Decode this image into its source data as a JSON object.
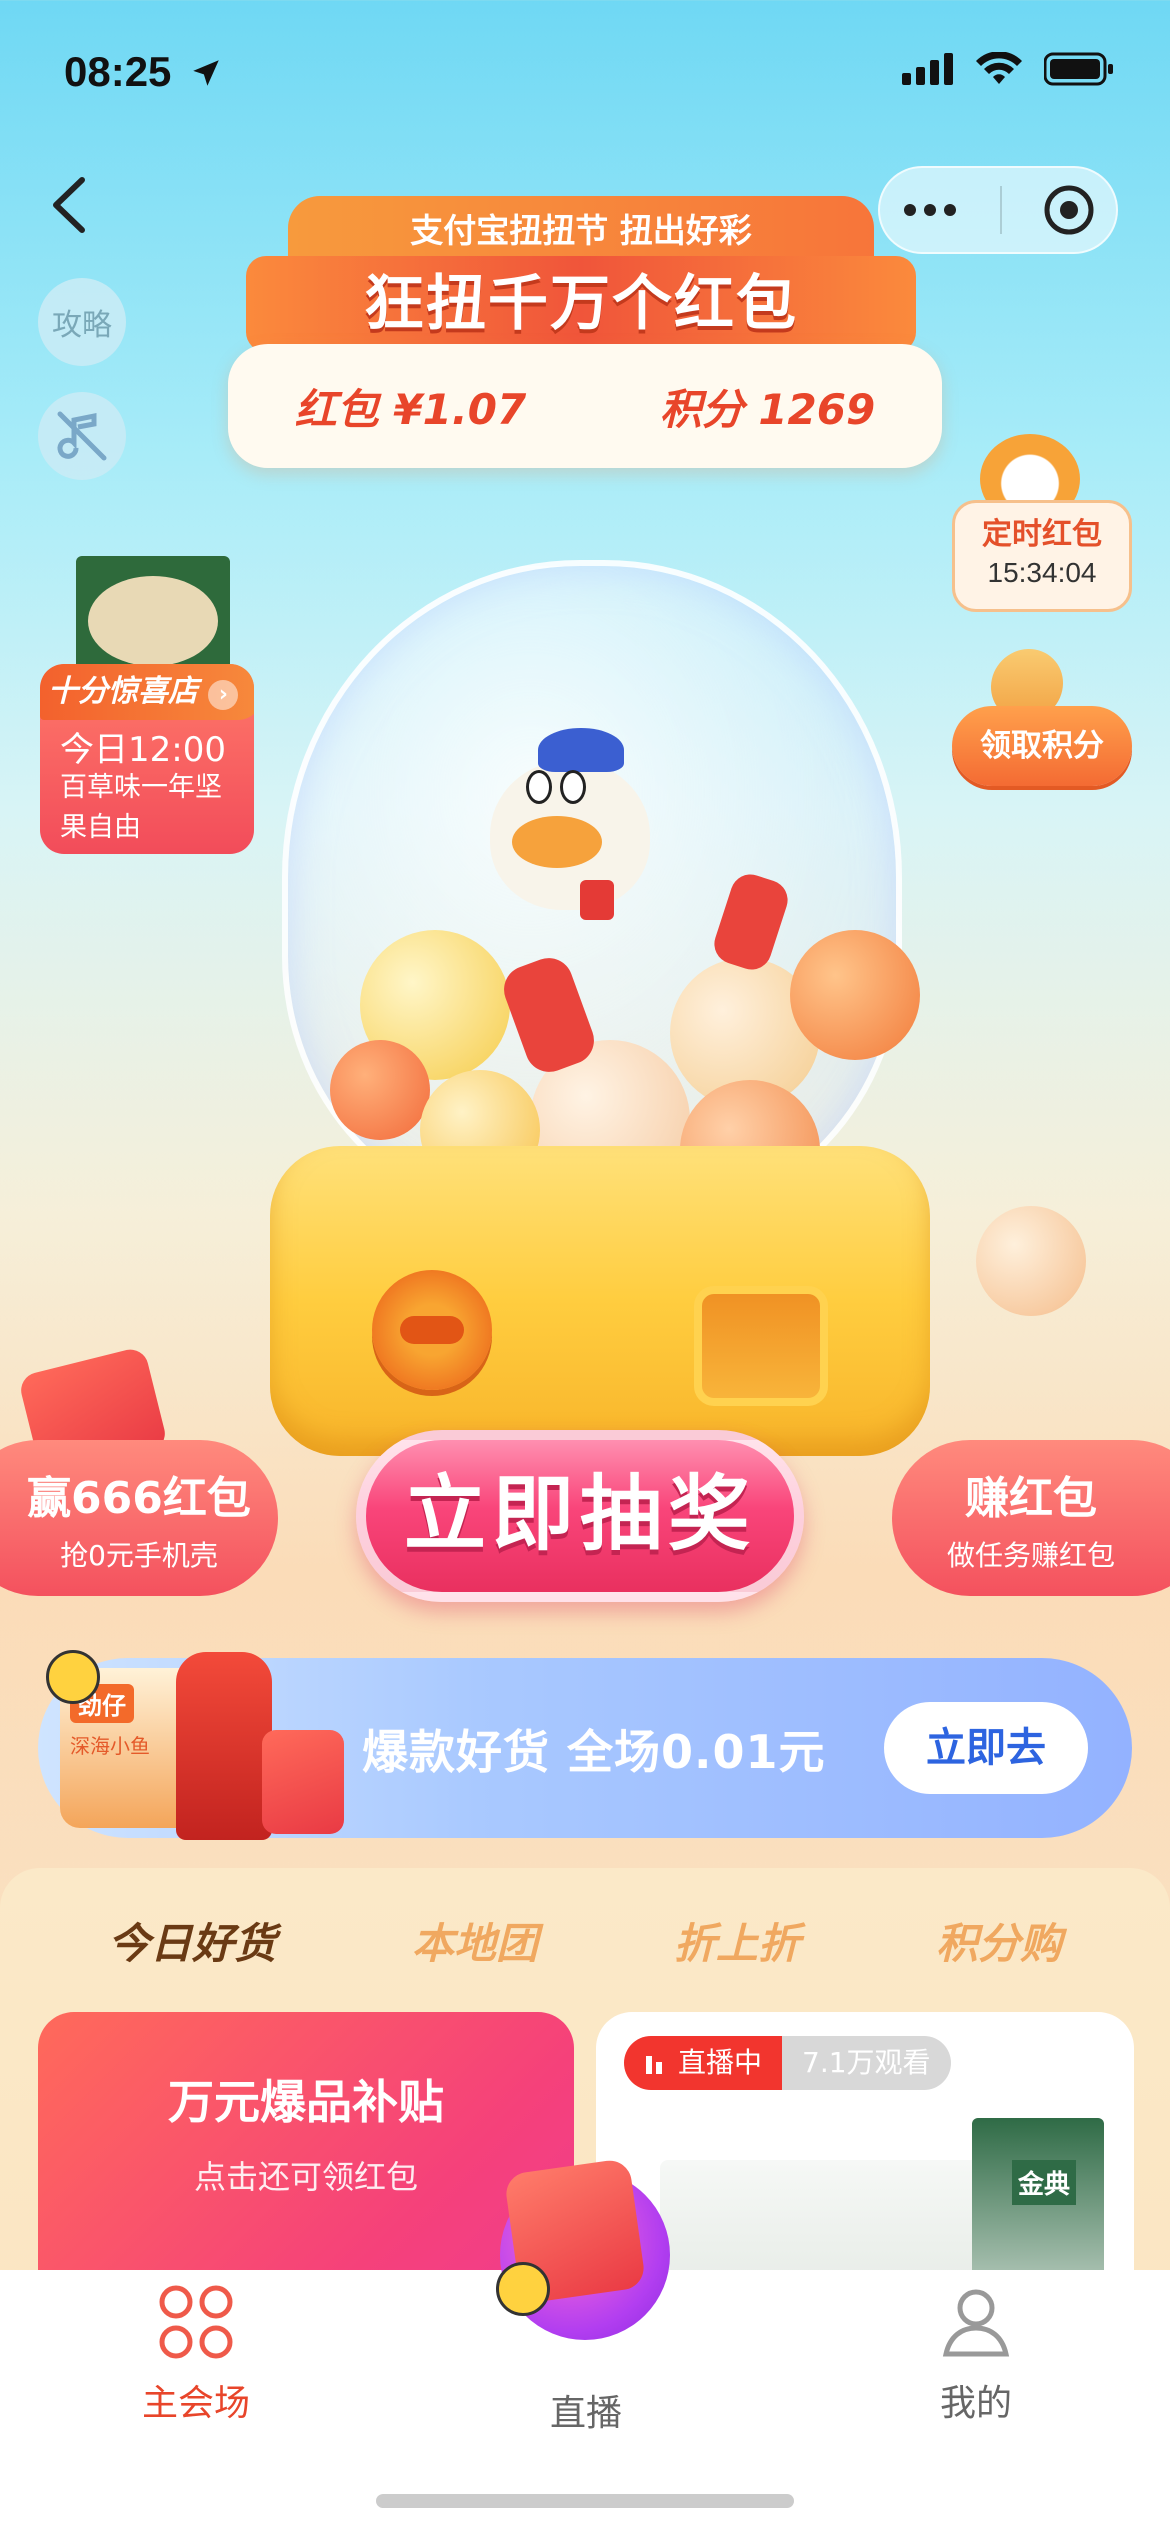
{
  "status_bar": {
    "time": "08:25"
  },
  "header": {
    "banner_subtitle": "支付宝扭扭节 扭出好彩",
    "banner_title": "狂扭千万个红包",
    "redpacket_label": "红包 ¥1.07",
    "points_label": "积分 1269"
  },
  "left_actions": {
    "guide_label": "攻略"
  },
  "left_promo": {
    "title": "十分惊喜店",
    "time": "今日12:00",
    "desc": "百草味一年坚果自由"
  },
  "right_widgets": {
    "timer_title": "定时红包",
    "timer_countdown": "15:34:04",
    "points_button": "领取积分"
  },
  "actions": {
    "left_big": "赢666红包",
    "left_small": "抢0元手机壳",
    "draw_button": "立即抽奖",
    "right_big": "赚红包",
    "right_small": "做任务赚红包"
  },
  "promo_banner": {
    "text": "爆款好货 全场0.01元",
    "button": "立即去",
    "product_brand": "劲仔",
    "product_sub": "深海小鱼"
  },
  "goods": {
    "tabs": [
      {
        "label": "今日好货",
        "active": true
      },
      {
        "label": "本地团",
        "active": false
      },
      {
        "label": "折上折",
        "active": false
      },
      {
        "label": "积分购",
        "active": false
      }
    ],
    "card_left_title": "万元爆品补贴",
    "card_left_sub": "点击还可领红包",
    "live_badge": "直播中",
    "live_views": "7.1万观看",
    "milk_brand": "金典"
  },
  "tabbar": {
    "items": [
      {
        "label": "主会场",
        "active": true
      },
      {
        "label": "直播",
        "active": false
      },
      {
        "label": "我的",
        "active": false
      }
    ]
  },
  "colors": {
    "accent_red": "#e8452a",
    "draw_button_pink": "#f9457a",
    "promo_blue": "#2d64e0",
    "tab_active": "#e8452a"
  }
}
